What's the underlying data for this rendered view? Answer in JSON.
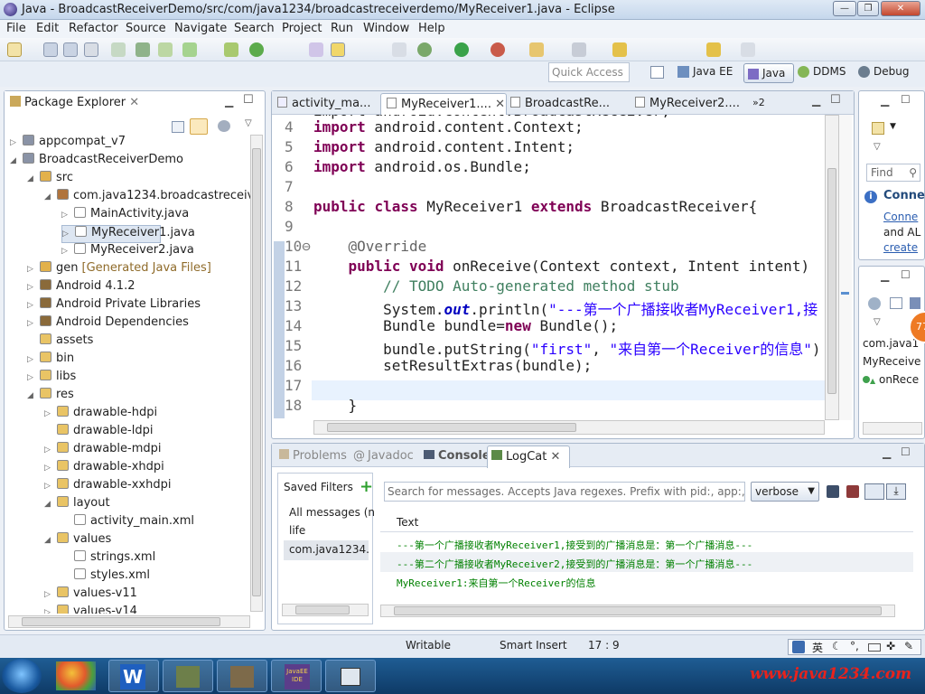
{
  "window": {
    "title": "Java - BroadcastReceiverDemo/src/com/java1234/broadcastreceiverdemo/MyReceiver1.java - Eclipse"
  },
  "menu": [
    "File",
    "Edit",
    "Refactor",
    "Source",
    "Navigate",
    "Search",
    "Project",
    "Run",
    "Window",
    "Help"
  ],
  "quick_access": "Quick Access",
  "perspectives": [
    "Java EE",
    "Java",
    "DDMS",
    "Debug"
  ],
  "package_explorer": {
    "title": "Package Explorer",
    "items": [
      {
        "label": "appcompat_v7",
        "level": 0,
        "arrow": "▷",
        "icon": "project-icon"
      },
      {
        "label": "BroadcastReceiverDemo",
        "level": 0,
        "arrow": "◢",
        "icon": "project-icon"
      },
      {
        "label": "src",
        "level": 1,
        "arrow": "◢",
        "icon": "src-folder-icon"
      },
      {
        "label": "com.java1234.broadcastreceiver",
        "level": 2,
        "arrow": "◢",
        "icon": "package-icon"
      },
      {
        "label": "MainActivity.java",
        "level": 3,
        "arrow": "▷",
        "icon": "java-file-icon"
      },
      {
        "label": "MyReceiver1.java",
        "level": 3,
        "arrow": "▷",
        "icon": "java-file-icon",
        "selected": true
      },
      {
        "label": "MyReceiver2.java",
        "level": 3,
        "arrow": "▷",
        "icon": "java-file-icon"
      },
      {
        "label": "gen",
        "suffix": "[Generated Java Files]",
        "level": 1,
        "arrow": "▷",
        "icon": "src-folder-icon"
      },
      {
        "label": "Android 4.1.2",
        "level": 1,
        "arrow": "▷",
        "icon": "library-icon"
      },
      {
        "label": "Android Private Libraries",
        "level": 1,
        "arrow": "▷",
        "icon": "library-icon"
      },
      {
        "label": "Android Dependencies",
        "level": 1,
        "arrow": "▷",
        "icon": "library-icon"
      },
      {
        "label": "assets",
        "level": 1,
        "arrow": "",
        "icon": "folder-icon"
      },
      {
        "label": "bin",
        "level": 1,
        "arrow": "▷",
        "icon": "folder-icon"
      },
      {
        "label": "libs",
        "level": 1,
        "arrow": "▷",
        "icon": "folder-icon"
      },
      {
        "label": "res",
        "level": 1,
        "arrow": "◢",
        "icon": "folder-icon"
      },
      {
        "label": "drawable-hdpi",
        "level": 2,
        "arrow": "▷",
        "icon": "folder-icon"
      },
      {
        "label": "drawable-ldpi",
        "level": 2,
        "arrow": "",
        "icon": "folder-icon"
      },
      {
        "label": "drawable-mdpi",
        "level": 2,
        "arrow": "▷",
        "icon": "folder-icon"
      },
      {
        "label": "drawable-xhdpi",
        "level": 2,
        "arrow": "▷",
        "icon": "folder-icon"
      },
      {
        "label": "drawable-xxhdpi",
        "level": 2,
        "arrow": "▷",
        "icon": "folder-icon"
      },
      {
        "label": "layout",
        "level": 2,
        "arrow": "◢",
        "icon": "folder-icon"
      },
      {
        "label": "activity_main.xml",
        "level": 3,
        "arrow": "",
        "icon": "xml-file-icon"
      },
      {
        "label": "values",
        "level": 2,
        "arrow": "◢",
        "icon": "folder-icon"
      },
      {
        "label": "strings.xml",
        "level": 3,
        "arrow": "",
        "icon": "xml-file-icon"
      },
      {
        "label": "styles.xml",
        "level": 3,
        "arrow": "",
        "icon": "xml-file-icon"
      },
      {
        "label": "values-v11",
        "level": 2,
        "arrow": "▷",
        "icon": "folder-icon"
      },
      {
        "label": "values-v14",
        "level": 2,
        "arrow": "▷",
        "icon": "folder-icon"
      }
    ]
  },
  "editor": {
    "tabs": [
      "activity_ma...",
      "MyReceiver1....",
      "BroadcastRe...",
      "MyReceiver2...."
    ],
    "overflow": "»2",
    "partial_top_line": "import android.content.BroadcastReceiver;",
    "lines": [
      {
        "n": "4",
        "tokens": [
          {
            "t": "import",
            "c": "kw"
          },
          {
            "t": " android.content.Context;"
          }
        ]
      },
      {
        "n": "5",
        "tokens": [
          {
            "t": "import",
            "c": "kw"
          },
          {
            "t": " android.content.Intent;"
          }
        ]
      },
      {
        "n": "6",
        "tokens": [
          {
            "t": "import",
            "c": "kw"
          },
          {
            "t": " android.os.Bundle;"
          }
        ]
      },
      {
        "n": "7",
        "tokens": []
      },
      {
        "n": "8",
        "tokens": [
          {
            "t": "public",
            "c": "kw"
          },
          {
            "t": " "
          },
          {
            "t": "class",
            "c": "kw"
          },
          {
            "t": " MyReceiver1 "
          },
          {
            "t": "extends",
            "c": "kw"
          },
          {
            "t": " BroadcastReceiver{"
          }
        ]
      },
      {
        "n": "9",
        "tokens": []
      },
      {
        "n": "10⊖",
        "tokens": [
          {
            "t": "    "
          },
          {
            "t": "@Override",
            "c": "an"
          }
        ]
      },
      {
        "n": "11",
        "tokens": [
          {
            "t": "    "
          },
          {
            "t": "public",
            "c": "kw"
          },
          {
            "t": " "
          },
          {
            "t": "void",
            "c": "kw"
          },
          {
            "t": " onReceive(Context context, Intent intent)"
          }
        ]
      },
      {
        "n": "12",
        "tokens": [
          {
            "t": "        "
          },
          {
            "t": "// ",
            "c": "cm"
          },
          {
            "t": "TODO",
            "c": "cm"
          },
          {
            "t": " Auto-generated method stub",
            "c": "cm"
          }
        ]
      },
      {
        "n": "13",
        "tokens": [
          {
            "t": "        System."
          },
          {
            "t": "out",
            "c": "it"
          },
          {
            "t": ".println("
          },
          {
            "t": "\"---第一个广播接收者MyReceiver1,接",
            "c": "str"
          }
        ]
      },
      {
        "n": "14",
        "tokens": [
          {
            "t": "        Bundle bundle="
          },
          {
            "t": "new",
            "c": "kw"
          },
          {
            "t": " Bundle();"
          }
        ]
      },
      {
        "n": "15",
        "tokens": [
          {
            "t": "        bundle.putString("
          },
          {
            "t": "\"first\"",
            "c": "str"
          },
          {
            "t": ", "
          },
          {
            "t": "\"来自第一个Receiver的信息\"",
            "c": "str"
          },
          {
            "t": ")"
          }
        ]
      },
      {
        "n": "16",
        "tokens": [
          {
            "t": "        setResultExtras(bundle);"
          }
        ]
      },
      {
        "n": "17",
        "tokens": []
      },
      {
        "n": "18",
        "tokens": [
          {
            "t": "    }"
          }
        ]
      }
    ]
  },
  "right_panel": {
    "find": "Find",
    "heading": "Conne",
    "link1": "Conne",
    "text": "and AL",
    "link2": "create",
    "outline1": "com.java1",
    "outline2": "MyReceive",
    "outline3": "onRece",
    "badge": "77"
  },
  "bottom": {
    "tabs": [
      "Problems",
      "Javadoc",
      "Console",
      "LogCat"
    ],
    "saved_filters": "Saved Filters",
    "filters": [
      "All messages (n",
      "life",
      "com.java1234.b"
    ],
    "search_placeholder": "Search for messages. Accepts Java regexes. Prefix with pid:, app:, ta",
    "level": "verbose",
    "column": "Text",
    "messages": [
      "---第一个广播接收者MyReceiver1,接受到的广播消息是：第一个广播消息---",
      "---第二个广播接收者MyReceiver2,接受到的广播消息是：第一个广播消息---",
      "MyReceiver1:来自第一个Receiver的信息"
    ]
  },
  "status": {
    "writable": "Writable",
    "insert": "Smart Insert",
    "position": "17 : 9",
    "ime": "英"
  },
  "taskbar": {
    "app_w": "W",
    "javaee": "JavaEE IDE",
    "watermark": "www.java1234.com"
  }
}
